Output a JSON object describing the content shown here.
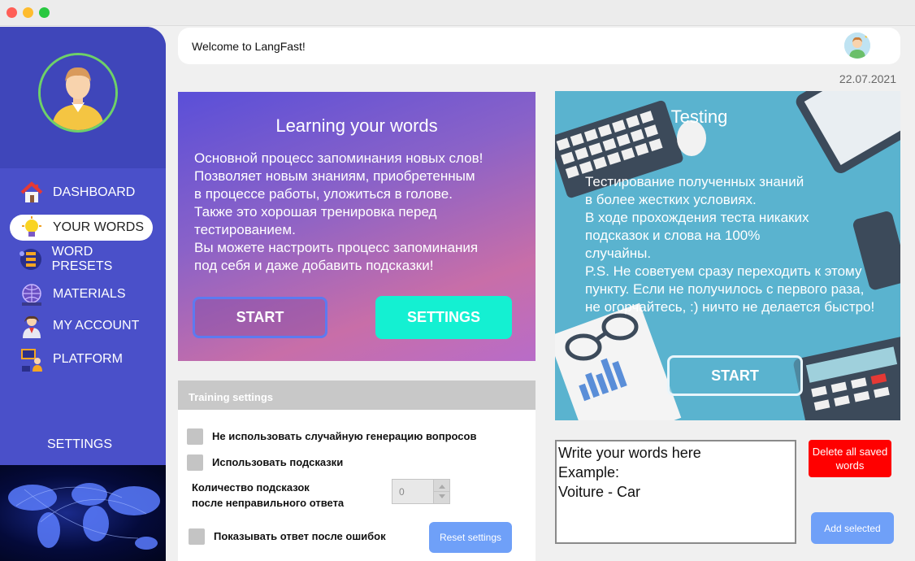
{
  "window": {
    "controls": [
      "close-icon",
      "minimize-icon",
      "zoom-icon"
    ],
    "control_colors": {
      "close": "#ff5f57",
      "minimize": "#febc2e",
      "zoom": "#28c840"
    }
  },
  "sidebar": {
    "avatar": "user-avatar-icon",
    "items": [
      {
        "label": "DASHBOARD",
        "icon": "home-icon"
      },
      {
        "label": "YOUR WORDS",
        "icon": "lightbulb-icon",
        "active": true
      },
      {
        "label": "WORD PRESETS",
        "icon": "presets-icon"
      },
      {
        "label": "MATERIALS",
        "icon": "globe-book-icon"
      },
      {
        "label": "MY ACCOUNT",
        "icon": "account-icon"
      },
      {
        "label": "PLATFORM",
        "icon": "platform-icon"
      }
    ],
    "settings_label": "SETTINGS",
    "bg_color": "#4a50c9"
  },
  "header": {
    "welcome": "Welcome to LangFast!",
    "date": "22.07.2021"
  },
  "learning_card": {
    "title": "Learning your words",
    "description": "Основной процесс запоминания новых слов!\nПозволяет новым знаниям, приобретенным\nв процессе работы, уложиться в голове.\nТакже это хорошая тренировка перед\nтестированием.\nВы можете настроить процесс запоминания\nпод себя и даже добавить подсказки!",
    "start_label": "START",
    "settings_label": "SETTINGS",
    "settings_color": "#14f0d2"
  },
  "testing_card": {
    "title": "Testing",
    "description": "Тестирование полученных знаний\nв более жестких условиях.\nВ ходе прохождения теста никаких\nподсказок и слова на 100%\nслучайны.\nP.S. Не советуем сразу переходить к этому\nпункту. Если не получилось с первого раза,\nне огорчайтесь, :) ничто не делается быстро!",
    "start_label": "START"
  },
  "training_settings": {
    "header": "Training settings",
    "options": [
      {
        "label": "Не использовать случайную генерацию вопросов",
        "checked": false
      },
      {
        "label": "Использовать подсказки",
        "checked": false
      }
    ],
    "hint_count_label_1": "Количество подсказок",
    "hint_count_label_2": "после неправильного ответа",
    "hint_count_value": "0",
    "show_answer_label": "Показывать ответ после ошибок",
    "reset_label": "Reset settings"
  },
  "words": {
    "text": "Write your words here\nExample:\nVoiture - Car",
    "delete_label": "Delete all saved words",
    "add_label": "Add selected",
    "delete_color": "#ff0000",
    "add_color": "#6fa0f8"
  }
}
